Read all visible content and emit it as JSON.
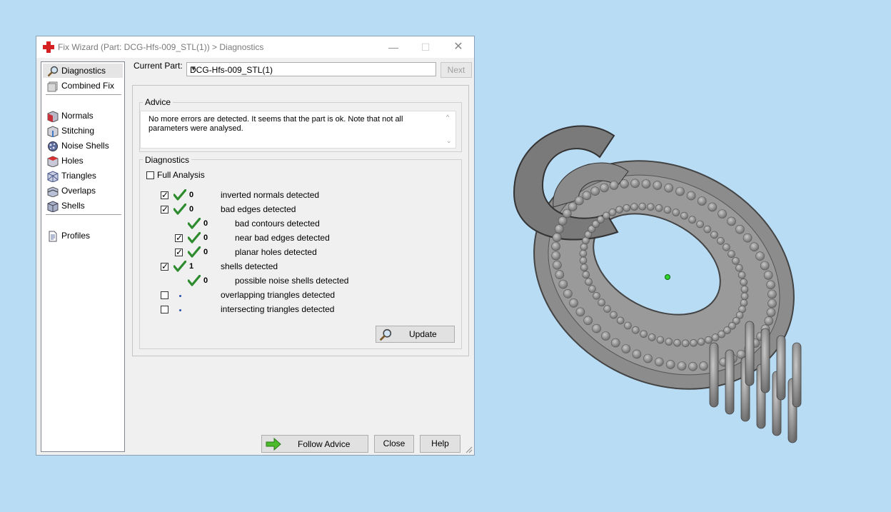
{
  "window": {
    "title": "Fix Wizard (Part: DCG-Hfs-009_STL(1)) > Diagnostics",
    "min_glyph": "—",
    "max_glyph": "☐",
    "close_glyph": "✕"
  },
  "nav": {
    "items": [
      {
        "label": "Diagnostics",
        "icon": "magnifier-icon"
      },
      {
        "label": "Combined Fix",
        "icon": "cubes-icon"
      },
      {
        "label": "Normals",
        "icon": "normals-cube-icon"
      },
      {
        "label": "Stitching",
        "icon": "stitching-cube-icon"
      },
      {
        "label": "Noise Shells",
        "icon": "noise-shells-icon"
      },
      {
        "label": "Holes",
        "icon": "holes-cube-icon"
      },
      {
        "label": "Triangles",
        "icon": "triangles-icon"
      },
      {
        "label": "Overlaps",
        "icon": "overlaps-icon"
      },
      {
        "label": "Shells",
        "icon": "shells-cube-icon"
      },
      {
        "label": "Profiles",
        "icon": "document-icon"
      }
    ]
  },
  "current_part": {
    "label": "Current Part:",
    "value": "DCG-Hfs-009_STL(1)",
    "next_label": "Next"
  },
  "advice": {
    "title": "Advice",
    "text": "No more errors are detected. It seems that the part is ok. Note that not all parameters were analysed."
  },
  "diagnostics": {
    "title": "Diagnostics",
    "full_analysis_label": "Full Analysis",
    "rows": [
      {
        "checked": true,
        "status": "ok",
        "count": "0",
        "label": "inverted normals detected"
      },
      {
        "checked": true,
        "status": "ok",
        "count": "0",
        "label": "bad edges detected"
      },
      {
        "checked": null,
        "status": "ok",
        "count": "0",
        "label": "bad contours detected"
      },
      {
        "checked": true,
        "status": "ok",
        "count": "0",
        "label": "near bad edges detected"
      },
      {
        "checked": true,
        "status": "ok",
        "count": "0",
        "label": "planar holes detected"
      },
      {
        "checked": true,
        "status": "ok",
        "count": "1",
        "label": "shells detected"
      },
      {
        "checked": null,
        "status": "ok",
        "count": "0",
        "label": "possible noise shells detected"
      },
      {
        "checked": false,
        "status": "pending",
        "count": "",
        "label": "overlapping triangles detected"
      },
      {
        "checked": false,
        "status": "pending",
        "count": "",
        "label": "intersecting triangles detected"
      }
    ],
    "update_label": "Update"
  },
  "footer": {
    "follow_advice_label": "Follow Advice",
    "close_label": "Close",
    "help_label": "Help"
  },
  "colors": {
    "background": "#b9dcf5",
    "ok_tick": "#2e8b2e",
    "model_gray": "#8c8c8c"
  }
}
